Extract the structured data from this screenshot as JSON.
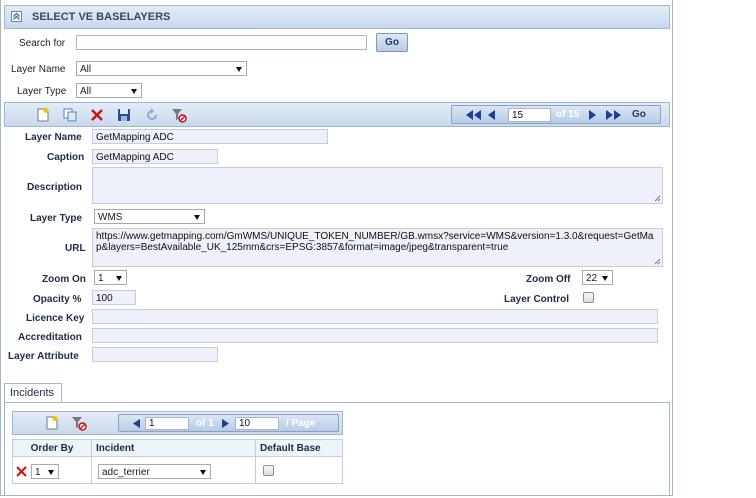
{
  "panel": {
    "title": "SELECT VE BASELAYERS"
  },
  "filters": {
    "search_label": "Search for",
    "search_value": "",
    "go_label": "Go",
    "layer_name_label": "Layer Name",
    "layer_name_value": "All",
    "layer_type_label": "Layer Type",
    "layer_type_value": "All"
  },
  "pager": {
    "current": "15",
    "of_text": "of 15",
    "go_label": "Go"
  },
  "form": {
    "layer_name_label": "Layer Name",
    "layer_name_value": "GetMapping ADC",
    "caption_label": "Caption",
    "caption_value": "GetMapping ADC",
    "description_label": "Description",
    "description_value": "",
    "layer_type_label": "Layer Type",
    "layer_type_value": "WMS",
    "url_label": "URL",
    "url_value": "https://www.getmapping.com/GmWMS/UNIQUE_TOKEN_NUMBER/GB.wmsx?service=WMS&version=1.3.0&request=GetMap&layers=BestAvailable_UK_125mm&crs=EPSG:3857&format=image/jpeg&transparent=true",
    "zoom_on_label": "Zoom On",
    "zoom_on_value": "1",
    "zoom_off_label": "Zoom Off",
    "zoom_off_value": "22",
    "opacity_label": "Opacity %",
    "opacity_value": "100",
    "layer_control_label": "Layer Control",
    "licence_key_label": "Licence Key",
    "licence_key_value": "",
    "accreditation_label": "Accreditation",
    "accreditation_value": "",
    "layer_attribute_label": "Layer Attribute",
    "layer_attribute_value": ""
  },
  "incidents": {
    "tab_label": "Incidents",
    "pager": {
      "page_value": "1",
      "of_text": "of 1",
      "page_size": "10",
      "per_page_label": "/ Page"
    },
    "columns": [
      "Order By",
      "Incident",
      "Default Base"
    ],
    "rows": [
      {
        "order": "1",
        "incident": "adc_terrier"
      }
    ]
  },
  "colors": {
    "header_bg": "#c8d9ee",
    "accent": "#1f3a64",
    "delete_red": "#cc1111"
  }
}
